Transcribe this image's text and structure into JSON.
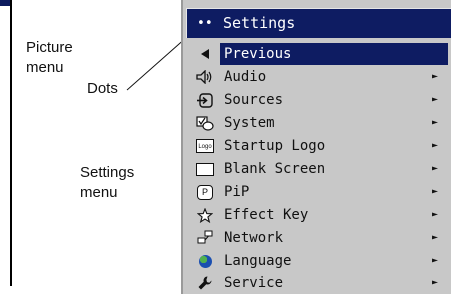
{
  "captions": {
    "picture_menu": "Picture\nmenu",
    "dots": "Dots",
    "settings_menu": "Settings\nmenu"
  },
  "menu": {
    "title_dots": "••",
    "title": "Settings",
    "items": [
      {
        "label": "Previous",
        "icon": "left-triangle-icon",
        "glyph": "◄",
        "selected": true,
        "submenu": false
      },
      {
        "label": "Audio",
        "icon": "speaker-icon",
        "glyph": "🕪",
        "selected": false,
        "submenu": true
      },
      {
        "label": "Sources",
        "icon": "source-input-icon",
        "glyph": "⮊",
        "selected": false,
        "submenu": true
      },
      {
        "label": "System",
        "icon": "system-icon",
        "glyph": "☑",
        "selected": false,
        "submenu": true
      },
      {
        "label": "Startup Logo",
        "icon": "logo-box-icon",
        "glyph": "Logo",
        "selected": false,
        "submenu": true
      },
      {
        "label": "Blank Screen",
        "icon": "blank-screen-icon",
        "glyph": "",
        "selected": false,
        "submenu": true
      },
      {
        "label": "PiP",
        "icon": "pip-icon",
        "glyph": "P",
        "selected": false,
        "submenu": true
      },
      {
        "label": "Effect Key",
        "icon": "star-icon",
        "glyph": "☆",
        "selected": false,
        "submenu": true
      },
      {
        "label": "Network",
        "icon": "network-icon",
        "glyph": "🖧",
        "selected": false,
        "submenu": true
      },
      {
        "label": "Language",
        "icon": "globe-icon",
        "glyph": "",
        "selected": false,
        "submenu": true
      },
      {
        "label": "Service",
        "icon": "wrench-icon",
        "glyph": "🔧",
        "selected": false,
        "submenu": true
      }
    ],
    "submenu_arrow": "►"
  },
  "colors": {
    "title_bar": "#0e1c62",
    "menu_bg": "#c8c8c8",
    "selected_bg": "#0e1c62"
  }
}
